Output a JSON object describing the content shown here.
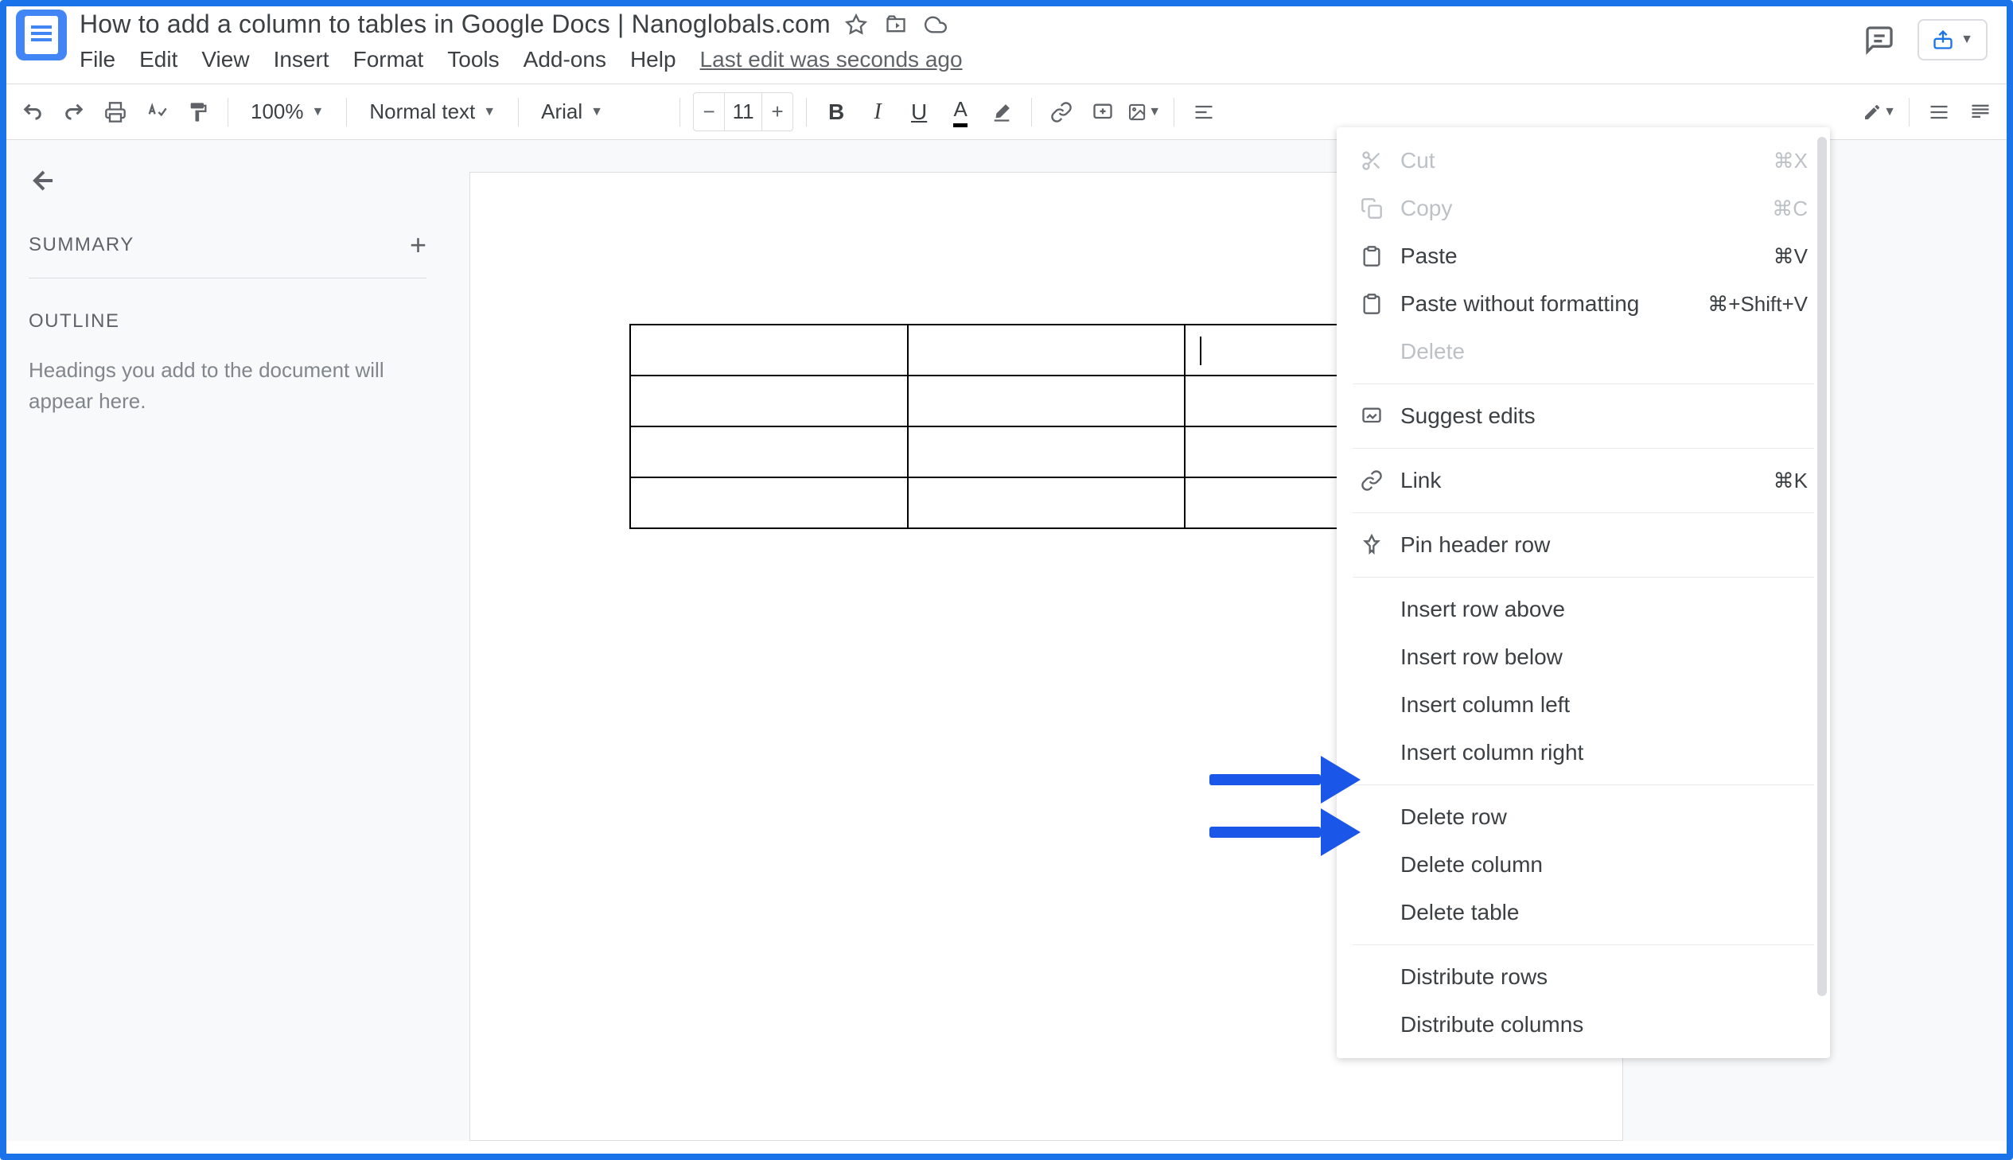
{
  "doc_title": "How to add a column to tables in Google Docs | Nanoglobals.com",
  "menu": [
    "File",
    "Edit",
    "View",
    "Insert",
    "Format",
    "Tools",
    "Add-ons",
    "Help"
  ],
  "last_edit": "Last edit was seconds ago",
  "toolbar": {
    "zoom": "100%",
    "style": "Normal text",
    "font": "Arial",
    "font_size": "11"
  },
  "sidebar": {
    "summary_label": "SUMMARY",
    "outline_label": "OUTLINE",
    "outline_hint": "Headings you add to the document will appear here."
  },
  "context_menu": {
    "cut": {
      "label": "Cut",
      "shortcut": "⌘X"
    },
    "copy": {
      "label": "Copy",
      "shortcut": "⌘C"
    },
    "paste": {
      "label": "Paste",
      "shortcut": "⌘V"
    },
    "paste_no_fmt": {
      "label": "Paste without formatting",
      "shortcut": "⌘+Shift+V"
    },
    "delete": {
      "label": "Delete"
    },
    "suggest": {
      "label": "Suggest edits"
    },
    "link": {
      "label": "Link",
      "shortcut": "⌘K"
    },
    "pin_header": {
      "label": "Pin header row"
    },
    "insert_row_above": {
      "label": "Insert row above"
    },
    "insert_row_below": {
      "label": "Insert row below"
    },
    "insert_col_left": {
      "label": "Insert column left"
    },
    "insert_col_right": {
      "label": "Insert column right"
    },
    "delete_row": {
      "label": "Delete row"
    },
    "delete_col": {
      "label": "Delete column"
    },
    "delete_table": {
      "label": "Delete table"
    },
    "distribute_rows": {
      "label": "Distribute rows"
    },
    "distribute_cols": {
      "label": "Distribute columns"
    }
  }
}
